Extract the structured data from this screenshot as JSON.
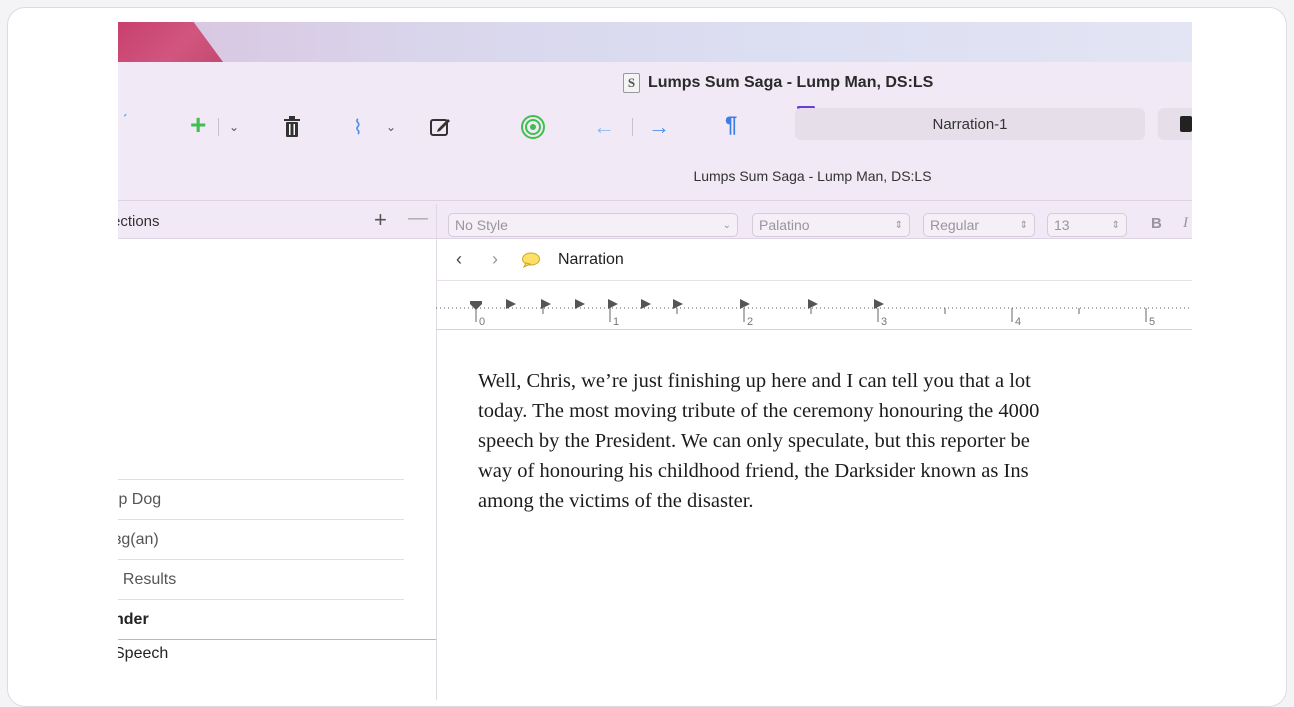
{
  "window": {
    "title": "Lumps Sum Saga - Lump Man, DS:LS",
    "doc_icon_letter": "S"
  },
  "toolbar": {
    "add_icon": "plus-icon",
    "trash_icon": "trash-icon",
    "attach_icon": "paperclip-icon",
    "compose_icon": "compose-icon",
    "target_icon": "target-icon",
    "back_icon": "arrow-left-icon",
    "forward_icon": "arrow-right-icon",
    "paragraph_glyph": "¶",
    "narration_field": "Narration-1"
  },
  "subtitle": "Lumps Sum Saga - Lump Man, DS:LS",
  "collections": {
    "label": "ections",
    "add": "+",
    "remove": "—"
  },
  "format_bar": {
    "style": "No Style",
    "font": "Palatino",
    "weight": "Regular",
    "size": "13",
    "bold": "B",
    "italic": "I"
  },
  "sidebar": {
    "items": [
      {
        "label": "ıp Dog"
      },
      {
        "label": "ɜg(an)"
      },
      {
        "label": "ı Results"
      },
      {
        "label": "nder"
      },
      {
        "label": "Speech"
      }
    ]
  },
  "navigator": {
    "label": "Narration"
  },
  "ruler": {
    "labels": [
      "0",
      "1",
      "2",
      "3",
      "4",
      "5"
    ]
  },
  "editor": {
    "lines": [
      "Well, Chris, we’re just finishing up here and I can tell you that a lot",
      "today. The most moving tribute of the ceremony honouring the 4000",
      "speech by the President. We can only speculate, but this reporter be",
      "way of honouring his childhood friend, the Darksider known as Ins",
      "among the victims of the disaster."
    ]
  },
  "colors": {
    "chrome_bg": "#f1e9f5",
    "accent_blue": "#4f8fe8",
    "accent_green": "#3fbf4f",
    "accent_purple": "#6a3fd6"
  }
}
